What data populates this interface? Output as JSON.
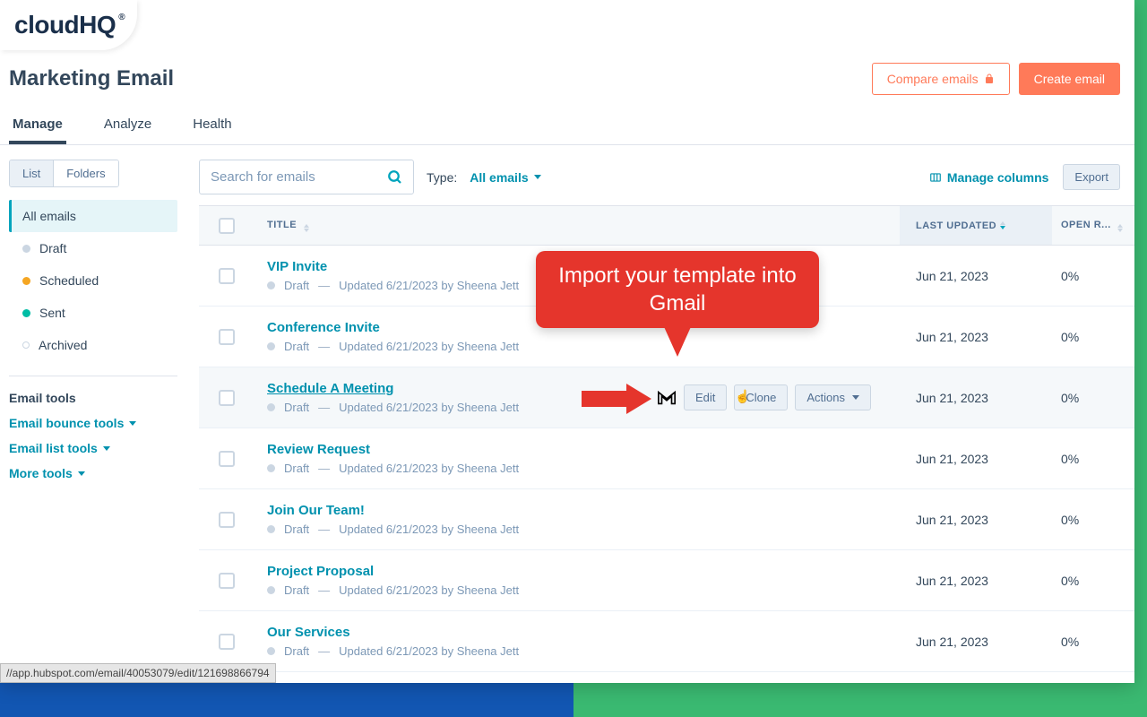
{
  "logo": "cloudHQ",
  "page_title": "Marketing Email",
  "header_buttons": {
    "compare": "Compare emails",
    "create": "Create email"
  },
  "tabs": [
    "Manage",
    "Analyze",
    "Health"
  ],
  "view_toggle": [
    "List",
    "Folders"
  ],
  "filters": [
    {
      "label": "All emails",
      "dot": ""
    },
    {
      "label": "Draft",
      "dot": "gray"
    },
    {
      "label": "Scheduled",
      "dot": "orange"
    },
    {
      "label": "Sent",
      "dot": "teal"
    },
    {
      "label": "Archived",
      "dot": "hollow"
    }
  ],
  "tools_heading": "Email tools",
  "tool_links": [
    "Email bounce tools",
    "Email list tools",
    "More tools"
  ],
  "search_placeholder": "Search for emails",
  "type_label": "Type:",
  "type_value": "All emails",
  "manage_columns": "Manage columns",
  "export": "Export",
  "columns": {
    "title": "TITLE",
    "updated": "LAST UPDATED",
    "open": "OPEN R..."
  },
  "row_actions": {
    "edit": "Edit",
    "clone": "Clone",
    "actions": "Actions"
  },
  "emails": [
    {
      "title": "VIP Invite",
      "status": "Draft",
      "updated_by": "Updated 6/21/2023 by Sheena Jett",
      "last_updated": "Jun 21, 2023",
      "open_rate": "0%"
    },
    {
      "title": "Conference Invite",
      "status": "Draft",
      "updated_by": "Updated 6/21/2023 by Sheena Jett",
      "last_updated": "Jun 21, 2023",
      "open_rate": "0%"
    },
    {
      "title": "Schedule A Meeting",
      "status": "Draft",
      "updated_by": "Updated 6/21/2023 by Sheena Jett",
      "last_updated": "Jun 21, 2023",
      "open_rate": "0%",
      "highlighted": true
    },
    {
      "title": "Review Request",
      "status": "Draft",
      "updated_by": "Updated 6/21/2023 by Sheena Jett",
      "last_updated": "Jun 21, 2023",
      "open_rate": "0%"
    },
    {
      "title": "Join Our Team!",
      "status": "Draft",
      "updated_by": "Updated 6/21/2023 by Sheena Jett",
      "last_updated": "Jun 21, 2023",
      "open_rate": "0%"
    },
    {
      "title": "Project Proposal",
      "status": "Draft",
      "updated_by": "Updated 6/21/2023 by Sheena Jett",
      "last_updated": "Jun 21, 2023",
      "open_rate": "0%"
    },
    {
      "title": "Our Services",
      "status": "Draft",
      "updated_by": "Updated 6/21/2023 by Sheena Jett",
      "last_updated": "Jun 21, 2023",
      "open_rate": "0%"
    }
  ],
  "callout_text": "Import your template into Gmail",
  "status_bar": "//app.hubspot.com/email/40053079/edit/121698866794"
}
